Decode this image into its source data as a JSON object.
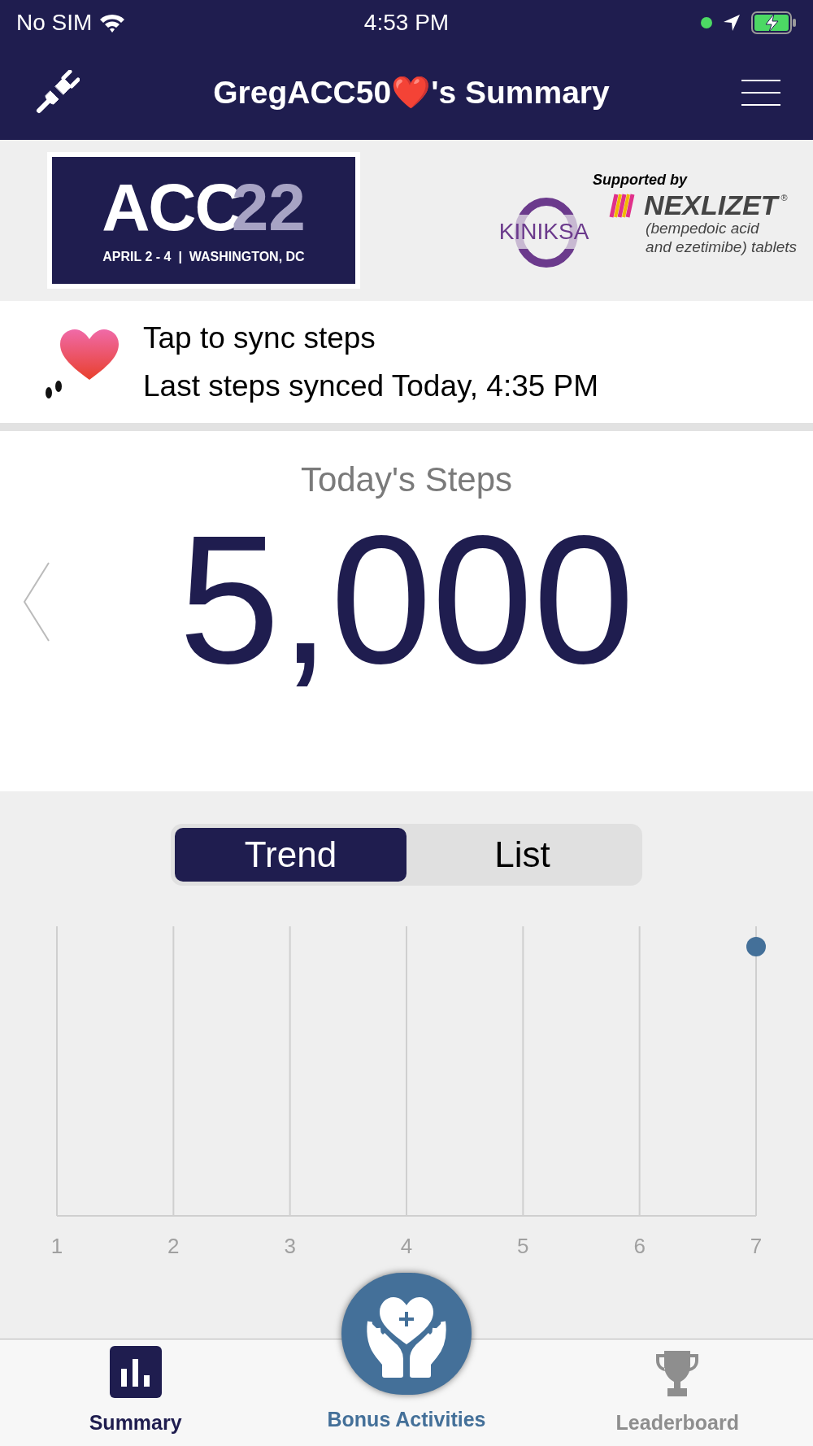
{
  "status_bar": {
    "carrier": "No SIM",
    "time": "4:53 PM"
  },
  "header": {
    "title": "GregACC50❤️'s Summary"
  },
  "banner": {
    "event_logo": {
      "big": "ACC",
      "year": "22",
      "subtitle": "APRIL 2 - 4  |  WASHINGTON, DC"
    },
    "supported_by": "Supported by",
    "sponsor_1": "KINIKSA",
    "sponsor_2": {
      "name": "NEXLIZET",
      "mark": "®",
      "line_1": "(bempedoic acid",
      "line_2": "and ezetimibe) tablets"
    }
  },
  "sync": {
    "action": "Tap to sync steps",
    "last_synced": "Last steps synced Today, 4:35 PM"
  },
  "steps": {
    "label": "Today's Steps",
    "value": "5,000"
  },
  "segments": [
    {
      "label": "Trend",
      "selected": true
    },
    {
      "label": "List",
      "selected": false
    }
  ],
  "chart": {
    "x_labels": [
      "1",
      "2",
      "3",
      "4",
      "5",
      "6",
      "7"
    ]
  },
  "tab_bar": [
    {
      "label": "Summary",
      "kind": "bars",
      "selected": true
    },
    {
      "label": "Bonus Activities",
      "kind": "hands",
      "selected": false
    },
    {
      "label": "Leaderboard",
      "kind": "trophy",
      "selected": false
    }
  ]
}
